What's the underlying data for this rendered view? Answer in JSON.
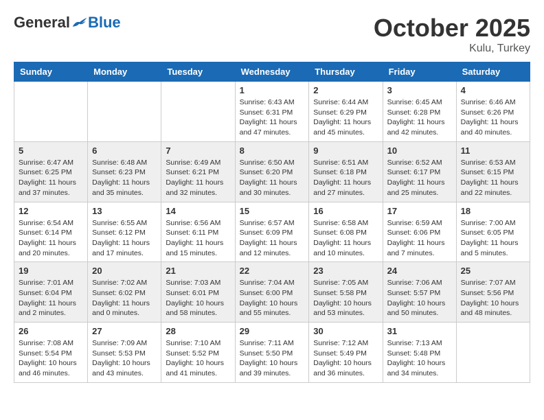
{
  "header": {
    "logo_general": "General",
    "logo_blue": "Blue",
    "month": "October 2025",
    "location": "Kulu, Turkey"
  },
  "days_of_week": [
    "Sunday",
    "Monday",
    "Tuesday",
    "Wednesday",
    "Thursday",
    "Friday",
    "Saturday"
  ],
  "weeks": [
    [
      {
        "day": "",
        "info": ""
      },
      {
        "day": "",
        "info": ""
      },
      {
        "day": "",
        "info": ""
      },
      {
        "day": "1",
        "info": "Sunrise: 6:43 AM\nSunset: 6:31 PM\nDaylight: 11 hours\nand 47 minutes."
      },
      {
        "day": "2",
        "info": "Sunrise: 6:44 AM\nSunset: 6:29 PM\nDaylight: 11 hours\nand 45 minutes."
      },
      {
        "day": "3",
        "info": "Sunrise: 6:45 AM\nSunset: 6:28 PM\nDaylight: 11 hours\nand 42 minutes."
      },
      {
        "day": "4",
        "info": "Sunrise: 6:46 AM\nSunset: 6:26 PM\nDaylight: 11 hours\nand 40 minutes."
      }
    ],
    [
      {
        "day": "5",
        "info": "Sunrise: 6:47 AM\nSunset: 6:25 PM\nDaylight: 11 hours\nand 37 minutes."
      },
      {
        "day": "6",
        "info": "Sunrise: 6:48 AM\nSunset: 6:23 PM\nDaylight: 11 hours\nand 35 minutes."
      },
      {
        "day": "7",
        "info": "Sunrise: 6:49 AM\nSunset: 6:21 PM\nDaylight: 11 hours\nand 32 minutes."
      },
      {
        "day": "8",
        "info": "Sunrise: 6:50 AM\nSunset: 6:20 PM\nDaylight: 11 hours\nand 30 minutes."
      },
      {
        "day": "9",
        "info": "Sunrise: 6:51 AM\nSunset: 6:18 PM\nDaylight: 11 hours\nand 27 minutes."
      },
      {
        "day": "10",
        "info": "Sunrise: 6:52 AM\nSunset: 6:17 PM\nDaylight: 11 hours\nand 25 minutes."
      },
      {
        "day": "11",
        "info": "Sunrise: 6:53 AM\nSunset: 6:15 PM\nDaylight: 11 hours\nand 22 minutes."
      }
    ],
    [
      {
        "day": "12",
        "info": "Sunrise: 6:54 AM\nSunset: 6:14 PM\nDaylight: 11 hours\nand 20 minutes."
      },
      {
        "day": "13",
        "info": "Sunrise: 6:55 AM\nSunset: 6:12 PM\nDaylight: 11 hours\nand 17 minutes."
      },
      {
        "day": "14",
        "info": "Sunrise: 6:56 AM\nSunset: 6:11 PM\nDaylight: 11 hours\nand 15 minutes."
      },
      {
        "day": "15",
        "info": "Sunrise: 6:57 AM\nSunset: 6:09 PM\nDaylight: 11 hours\nand 12 minutes."
      },
      {
        "day": "16",
        "info": "Sunrise: 6:58 AM\nSunset: 6:08 PM\nDaylight: 11 hours\nand 10 minutes."
      },
      {
        "day": "17",
        "info": "Sunrise: 6:59 AM\nSunset: 6:06 PM\nDaylight: 11 hours\nand 7 minutes."
      },
      {
        "day": "18",
        "info": "Sunrise: 7:00 AM\nSunset: 6:05 PM\nDaylight: 11 hours\nand 5 minutes."
      }
    ],
    [
      {
        "day": "19",
        "info": "Sunrise: 7:01 AM\nSunset: 6:04 PM\nDaylight: 11 hours\nand 2 minutes."
      },
      {
        "day": "20",
        "info": "Sunrise: 7:02 AM\nSunset: 6:02 PM\nDaylight: 11 hours\nand 0 minutes."
      },
      {
        "day": "21",
        "info": "Sunrise: 7:03 AM\nSunset: 6:01 PM\nDaylight: 10 hours\nand 58 minutes."
      },
      {
        "day": "22",
        "info": "Sunrise: 7:04 AM\nSunset: 6:00 PM\nDaylight: 10 hours\nand 55 minutes."
      },
      {
        "day": "23",
        "info": "Sunrise: 7:05 AM\nSunset: 5:58 PM\nDaylight: 10 hours\nand 53 minutes."
      },
      {
        "day": "24",
        "info": "Sunrise: 7:06 AM\nSunset: 5:57 PM\nDaylight: 10 hours\nand 50 minutes."
      },
      {
        "day": "25",
        "info": "Sunrise: 7:07 AM\nSunset: 5:56 PM\nDaylight: 10 hours\nand 48 minutes."
      }
    ],
    [
      {
        "day": "26",
        "info": "Sunrise: 7:08 AM\nSunset: 5:54 PM\nDaylight: 10 hours\nand 46 minutes."
      },
      {
        "day": "27",
        "info": "Sunrise: 7:09 AM\nSunset: 5:53 PM\nDaylight: 10 hours\nand 43 minutes."
      },
      {
        "day": "28",
        "info": "Sunrise: 7:10 AM\nSunset: 5:52 PM\nDaylight: 10 hours\nand 41 minutes."
      },
      {
        "day": "29",
        "info": "Sunrise: 7:11 AM\nSunset: 5:50 PM\nDaylight: 10 hours\nand 39 minutes."
      },
      {
        "day": "30",
        "info": "Sunrise: 7:12 AM\nSunset: 5:49 PM\nDaylight: 10 hours\nand 36 minutes."
      },
      {
        "day": "31",
        "info": "Sunrise: 7:13 AM\nSunset: 5:48 PM\nDaylight: 10 hours\nand 34 minutes."
      },
      {
        "day": "",
        "info": ""
      }
    ]
  ]
}
